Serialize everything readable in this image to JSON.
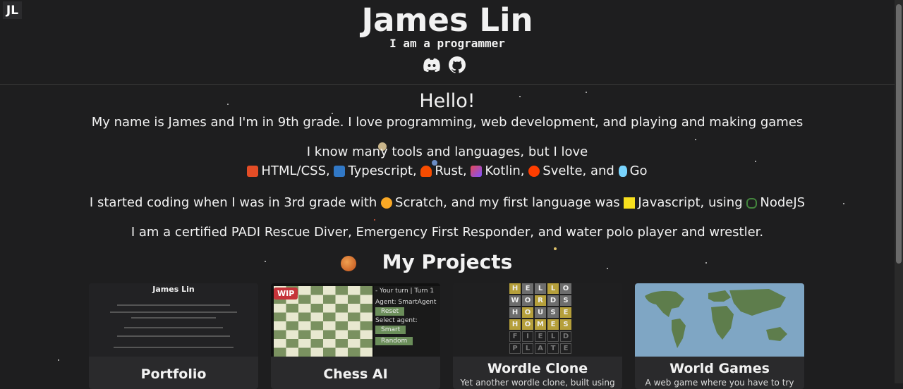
{
  "header": {
    "badge": "JL",
    "name": "James Lin",
    "tagline": "I am a programmer",
    "social_icons": [
      "discord-icon",
      "github-icon"
    ]
  },
  "intro": {
    "greeting": "Hello!",
    "about": "My name is James and I'm in 9th grade. I love programming, web development, and playing and making games",
    "tools_intro": "I know many tools and languages, but I love",
    "languages": [
      {
        "label": "HTML/CSS,",
        "icon": "html5-icon",
        "color": "#e44d26"
      },
      {
        "label": "Typescript,",
        "icon": "typescript-icon",
        "color": "#3178c6"
      },
      {
        "label": "Rust,",
        "icon": "rust-crab-icon",
        "color": "#f74c00"
      },
      {
        "label": "Kotlin,",
        "icon": "kotlin-icon",
        "color": "#7f52ff"
      },
      {
        "label": "Svelte, and",
        "icon": "svelte-icon",
        "color": "#ff3e00"
      },
      {
        "label": "Go",
        "icon": "gopher-icon",
        "color": "#79d4fd"
      }
    ],
    "started_prefix": "I started coding when I was in 3rd grade with",
    "scratch": "Scratch, and my first language was",
    "js": "Javascript, using",
    "node": "NodeJS",
    "certs": "I am a certified PADI Rescue Diver, Emergency First Responder, and water polo player and wrestler."
  },
  "projects": {
    "title": "My Projects",
    "cards": [
      {
        "title": "Portfolio",
        "preview_name": "James Lin"
      },
      {
        "title": "Chess AI",
        "badge": "WIP",
        "turn": "- Your turn | Turn 1",
        "agent": "Agent: SmartAgent",
        "reset": "Reset",
        "select": "Select agent:",
        "smart": "Smart",
        "random": "Random"
      },
      {
        "title": "Wordle Clone",
        "desc": "Yet another wordle clone, built using",
        "words": [
          "HELLO",
          "WORDS",
          "HOUSE",
          "HOMES",
          "FIELD",
          "PLATE"
        ]
      },
      {
        "title": "World Games",
        "desc": "A web game where you have to try"
      }
    ]
  },
  "colors": {
    "background": "#1e1e1f",
    "card": "#2a2a2c",
    "chess_light": "#e8e8d0",
    "chess_dark": "#7a9160",
    "wordle_yellow": "#b59f3b",
    "wordle_gray": "#6d6d6d",
    "map_ocean": "#7fa6c4",
    "map_land": "#5e7d4c"
  }
}
